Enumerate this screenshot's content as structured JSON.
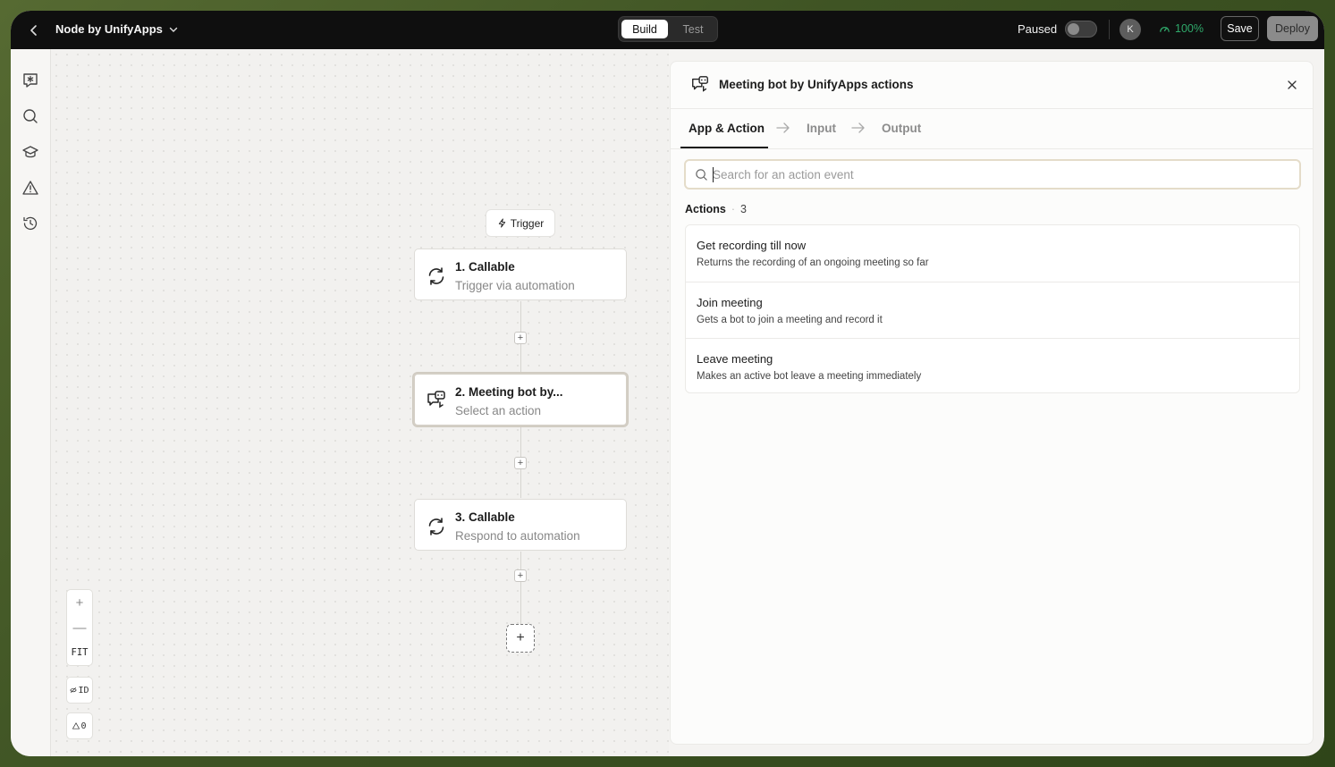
{
  "topbar": {
    "app_title": "Node by UnifyApps",
    "tabs": [
      {
        "label": "Build"
      },
      {
        "label": "Test"
      }
    ],
    "status_label": "Paused",
    "avatar_initial": "K",
    "health_value": "100%",
    "health_color": "#2fa86a",
    "save_label": "Save",
    "deploy_label": "Deploy"
  },
  "rail": {
    "icons": [
      "ai-assistant-icon",
      "search-icon",
      "graduation-cap-icon",
      "warning-icon",
      "history-icon"
    ]
  },
  "canvas": {
    "trigger_label": "Trigger",
    "nodes": [
      {
        "title": "1. Callable",
        "subtitle": "Trigger via automation",
        "icon": "sync-icon"
      },
      {
        "title": "2. Meeting bot by...",
        "subtitle": "Select an action",
        "icon": "meeting-bot-icon"
      },
      {
        "title": "3. Callable",
        "subtitle": "Respond to automation",
        "icon": "sync-icon"
      }
    ],
    "zoom_in": "+",
    "zoom_out": "—",
    "zoom_fit": "FIT",
    "id_toggle": "ID",
    "warnings_count": "0"
  },
  "panel": {
    "title": "Meeting bot by UnifyApps actions",
    "steps": [
      {
        "label": "App & Action"
      },
      {
        "label": "Input"
      },
      {
        "label": "Output"
      }
    ],
    "search_placeholder": "Search for an action event",
    "actions_label": "Actions",
    "actions_count": "3",
    "actions": [
      {
        "title": "Get recording till now",
        "description": "Returns the recording of an ongoing meeting so far"
      },
      {
        "title": "Join meeting",
        "description": "Gets a bot to join a meeting and record it"
      },
      {
        "title": "Leave meeting",
        "description": "Makes an active bot leave a meeting immediately"
      }
    ]
  }
}
